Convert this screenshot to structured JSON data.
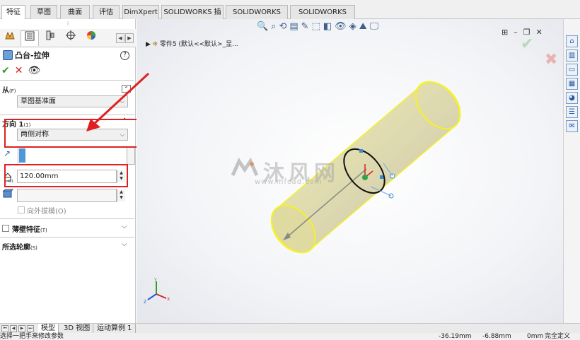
{
  "top_tabs": [
    {
      "label": "特征",
      "active": true
    },
    {
      "label": "草图",
      "active": false
    },
    {
      "label": "曲面",
      "active": false
    },
    {
      "label": "评估",
      "active": false
    },
    {
      "label": "DimXpert",
      "active": false
    },
    {
      "label": "SOLIDWORKS 插件",
      "active": false
    },
    {
      "label": "SOLIDWORKS MBD",
      "active": false
    },
    {
      "label": "SOLIDWORKS CAM",
      "active": false
    }
  ],
  "property_manager": {
    "title": "凸台-拉伸",
    "help": "?",
    "from_section": {
      "label": "从",
      "suffix": "(F)",
      "value": "草图基准面"
    },
    "direction1_section": {
      "label": "方向 1",
      "suffix": "(1)",
      "end_condition": "两侧对称",
      "depth": "120.00mm"
    },
    "draft_outward": "向外拔模(O)",
    "thin_feature": {
      "label": "薄壁特征",
      "suffix": "(T)"
    },
    "selected_contours": {
      "label": "所选轮廓",
      "suffix": "(S)"
    }
  },
  "viewport": {
    "tree_path": "零件5 (默认<<默认>_显..."
  },
  "watermark": {
    "text": "沐风网",
    "sub": "www.mfcad.com"
  },
  "bottom_tabs": [
    {
      "label": "模型",
      "active": true
    },
    {
      "label": "3D 视图",
      "active": false
    },
    {
      "label": "运动算例 1",
      "active": false
    }
  ],
  "status": {
    "hint": "选择一把手来修改参数",
    "x": "-36.19mm",
    "y": "-6.88mm",
    "z": "0mm",
    "state": "完全定义"
  },
  "colors": {
    "cylinder_fill": "#e3dfa9",
    "cylinder_edge": "#f5f225",
    "annotation_red": "#e02020",
    "ok_green": "#2f9a2f",
    "cancel_red": "#cc1f1f"
  }
}
